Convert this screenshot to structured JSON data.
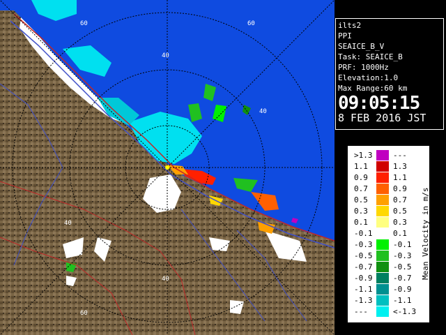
{
  "info_panel": {
    "site": "ilts2",
    "scan_type": "PPI",
    "product": "SEAICE_B_V",
    "task": "Task: SEAICE_B",
    "prf": "PRF: 1000Hz",
    "elevation": "Elevation:1.0",
    "max_range": "Max Range:60 km",
    "time": "09:05:15",
    "date": "8 FEB 2016 JST"
  },
  "map": {
    "range_ring_labels": [
      "40",
      "40",
      "60",
      "60",
      "40",
      "40",
      "60"
    ],
    "colors": {
      "sea": "#0f4be0",
      "land": "#7a6545",
      "snow": "#ffffff",
      "road_red": "#c02828",
      "road_blue": "#4050c8",
      "ring": "#000000"
    }
  },
  "legend": {
    "title": "Mean Velocity in m/s",
    "rows": [
      {
        "lo": ">1.3",
        "hi": "---",
        "color": "#c000c0"
      },
      {
        "lo": "1.1",
        "hi": "1.3",
        "color": "#d00000"
      },
      {
        "lo": "0.9",
        "hi": "1.1",
        "color": "#ff2000"
      },
      {
        "lo": "0.7",
        "hi": "0.9",
        "color": "#ff6000"
      },
      {
        "lo": "0.5",
        "hi": "0.7",
        "color": "#ffa000"
      },
      {
        "lo": "0.3",
        "hi": "0.5",
        "color": "#ffd800"
      },
      {
        "lo": "0.1",
        "hi": "0.3",
        "color": "#ffff80"
      },
      {
        "lo": "-0.1",
        "hi": "0.1",
        "color": "#ffffff"
      },
      {
        "lo": "-0.3",
        "hi": "-0.1",
        "color": "#00f000"
      },
      {
        "lo": "-0.5",
        "hi": "-0.3",
        "color": "#20c020"
      },
      {
        "lo": "-0.7",
        "hi": "-0.5",
        "color": "#109010"
      },
      {
        "lo": "-0.9",
        "hi": "-0.7",
        "color": "#008060"
      },
      {
        "lo": "-1.1",
        "hi": "-0.9",
        "color": "#009090"
      },
      {
        "lo": "-1.3",
        "hi": "-1.1",
        "color": "#00c0c0"
      },
      {
        "lo": "---",
        "hi": "<-1.3",
        "color": "#00f0f0"
      }
    ]
  }
}
